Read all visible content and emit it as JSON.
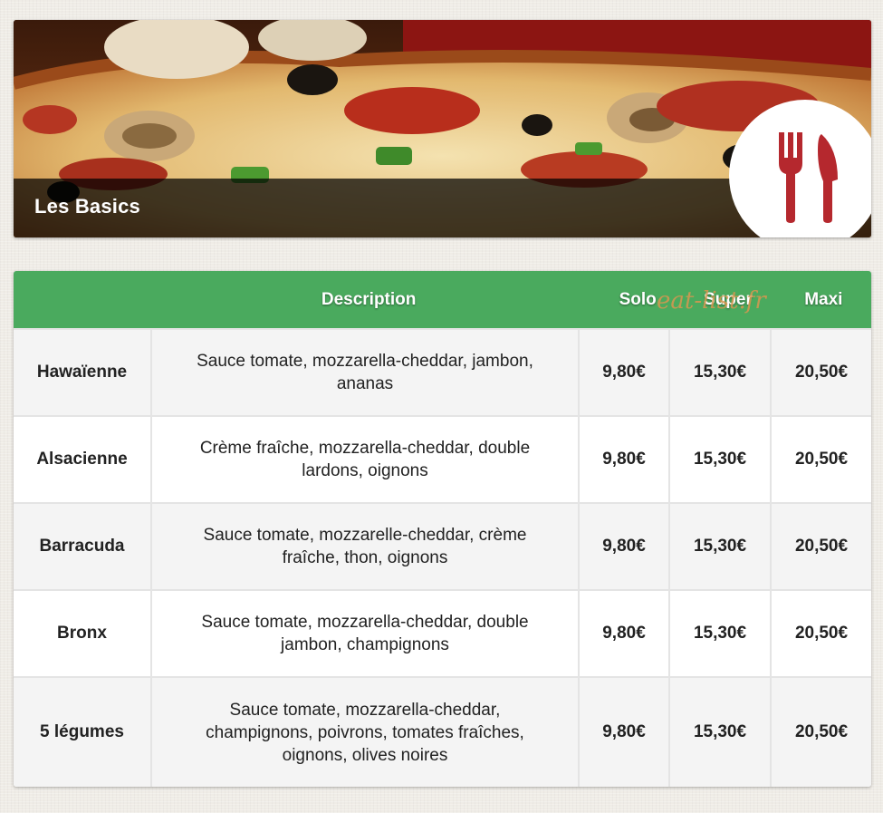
{
  "banner": {
    "title": "Les Basics",
    "icon": "fork-knife-icon",
    "accent_color": "#b5282e"
  },
  "table": {
    "header_color": "#4aaa5e",
    "columns": [
      "",
      "Description",
      "Solo",
      "Super",
      "Maxi"
    ],
    "watermark": "eat-list.fr",
    "rows": [
      {
        "name": "Hawaïenne",
        "description": "Sauce tomate, mozzarella-cheddar, jambon, ananas",
        "solo": "9,80€",
        "super": "15,30€",
        "maxi": "20,50€"
      },
      {
        "name": "Alsacienne",
        "description": "Crème fraîche, mozzarella-cheddar, double lardons, oignons",
        "solo": "9,80€",
        "super": "15,30€",
        "maxi": "20,50€"
      },
      {
        "name": "Barracuda",
        "description": "Sauce tomate, mozzarelle-cheddar, crème fraîche, thon, oignons",
        "solo": "9,80€",
        "super": "15,30€",
        "maxi": "20,50€"
      },
      {
        "name": "Bronx",
        "description": "Sauce tomate, mozzarella-cheddar, double jambon, champignons",
        "solo": "9,80€",
        "super": "15,30€",
        "maxi": "20,50€"
      },
      {
        "name": "5 légumes",
        "description": "Sauce tomate, mozzarella-cheddar, champignons, poivrons, tomates fraîches, oignons, olives noires",
        "solo": "9,80€",
        "super": "15,30€",
        "maxi": "20,50€"
      }
    ]
  }
}
